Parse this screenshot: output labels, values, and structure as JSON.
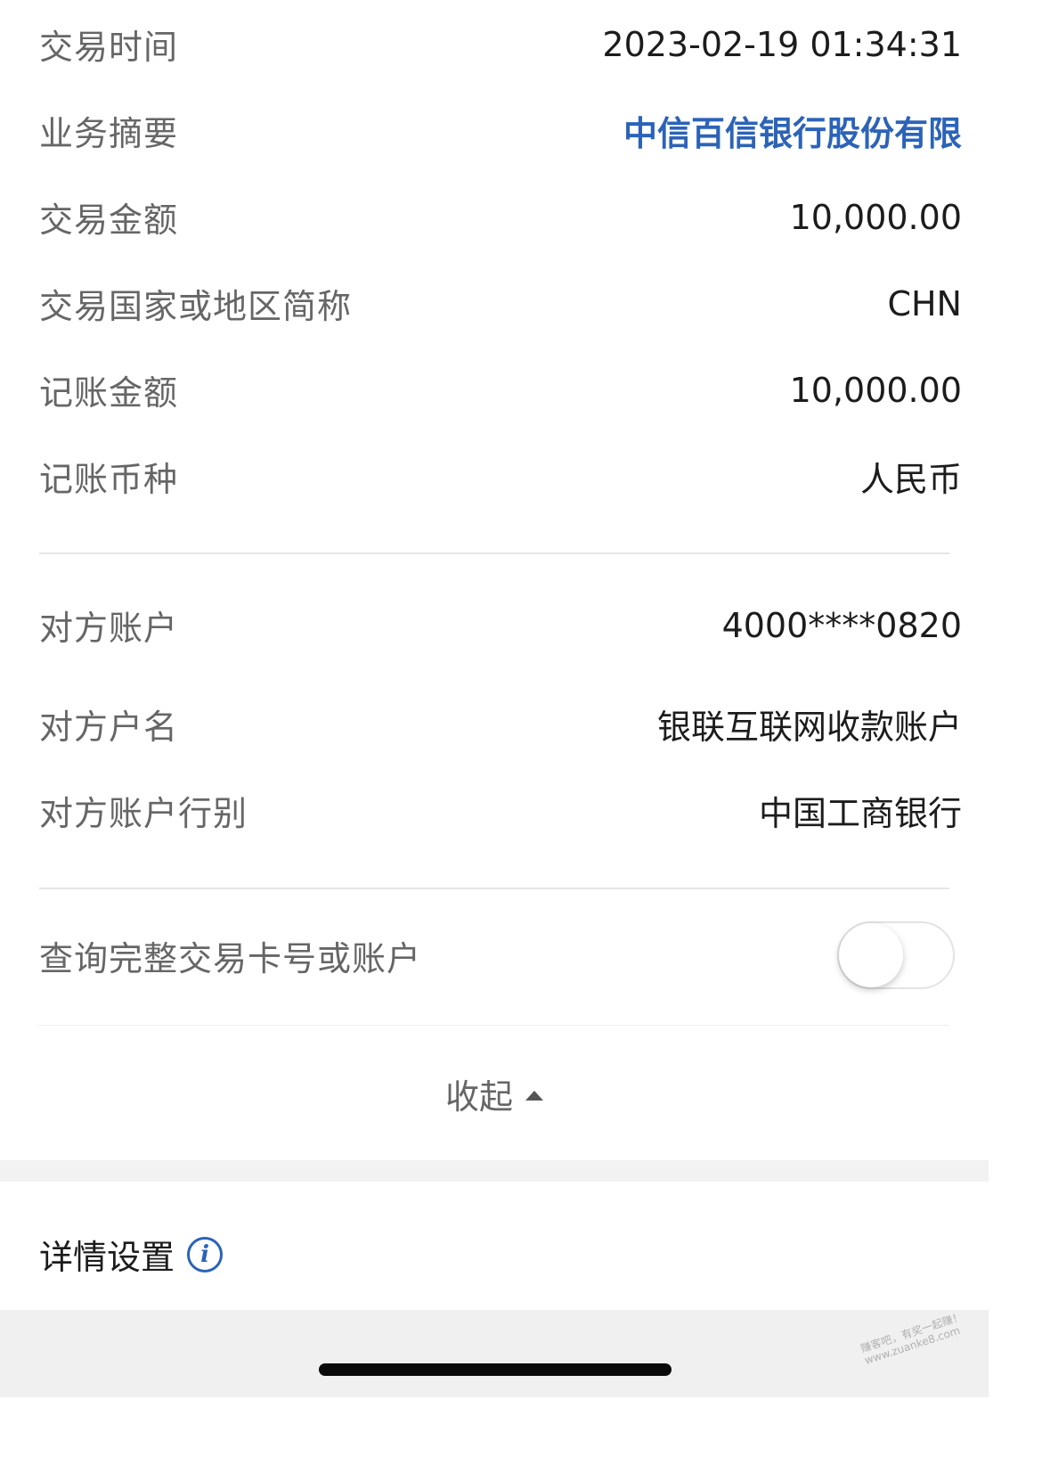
{
  "details": {
    "rows1": [
      {
        "label": "交易时间",
        "value": "2023-02-19 01:34:31"
      },
      {
        "label": "业务摘要",
        "value": "中信百信银行股份有限"
      },
      {
        "label": "交易金额",
        "value": "10,000.00"
      },
      {
        "label": "交易国家或地区简称",
        "value": "CHN"
      },
      {
        "label": "记账金额",
        "value": "10,000.00"
      },
      {
        "label": "记账币种",
        "value": "人民币"
      }
    ],
    "rows2": [
      {
        "label": "对方账户",
        "value": "4000****0820"
      },
      {
        "label": "对方户名",
        "value": "银联互联网收款账户"
      },
      {
        "label": "对方账户行别",
        "value": "中国工商银行"
      }
    ]
  },
  "full_card_toggle": {
    "label": "查询完整交易卡号或账户",
    "state": "off"
  },
  "collapse_label": "收起",
  "detail_settings": {
    "title": "详情设置",
    "info_icon": "i"
  },
  "watermark": {
    "line1": "赚客吧，有奖一起赚！",
    "line2": "www.zuanke8.com"
  },
  "colors": {
    "link_blue": "#2c63b8",
    "label_gray": "#666666",
    "value_dark": "#1c1c1c"
  }
}
